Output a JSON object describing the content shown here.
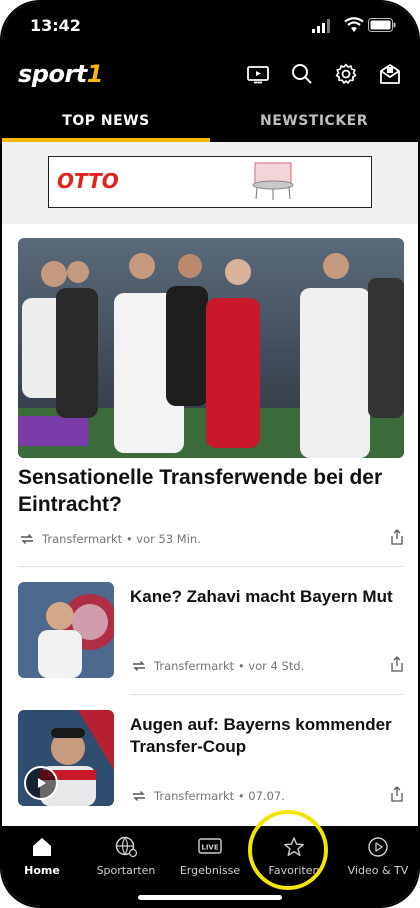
{
  "status": {
    "time": "13:42"
  },
  "header": {
    "logo_main": "sport",
    "logo_num": "1",
    "icons": [
      "tv-icon",
      "search-icon",
      "settings-icon",
      "inbox-icon"
    ]
  },
  "tabs": [
    {
      "label": "TOP NEWS",
      "active": true
    },
    {
      "label": "NEWSTICKER",
      "active": false
    }
  ],
  "ad": {
    "brand": "OTTO"
  },
  "hero": {
    "title": "Sensationelle Transferwende bei der Eintracht?",
    "meta": "Transfermarkt • vor 53 Min."
  },
  "articles": [
    {
      "title": "Kane? Zahavi macht Bayern Mut",
      "meta": "Transfermarkt • vor 4 Std."
    },
    {
      "title": "Augen auf: Bayerns kommender Transfer-Coup",
      "meta": "Transfermarkt • 07.07."
    }
  ],
  "bottom_nav": [
    {
      "label": "Home",
      "icon": "home-icon",
      "active": true
    },
    {
      "label": "Sportarten",
      "icon": "sports-ball-icon",
      "active": false
    },
    {
      "label": "Ergebnisse",
      "icon": "live-icon",
      "active": false
    },
    {
      "label": "Favoriten",
      "icon": "star-icon",
      "active": false
    },
    {
      "label": "Video & TV",
      "icon": "play-icon",
      "active": false
    }
  ],
  "colors": {
    "accent": "#f6b800",
    "otto_red": "#e3221b",
    "highlight_ring": "#f2e600"
  }
}
